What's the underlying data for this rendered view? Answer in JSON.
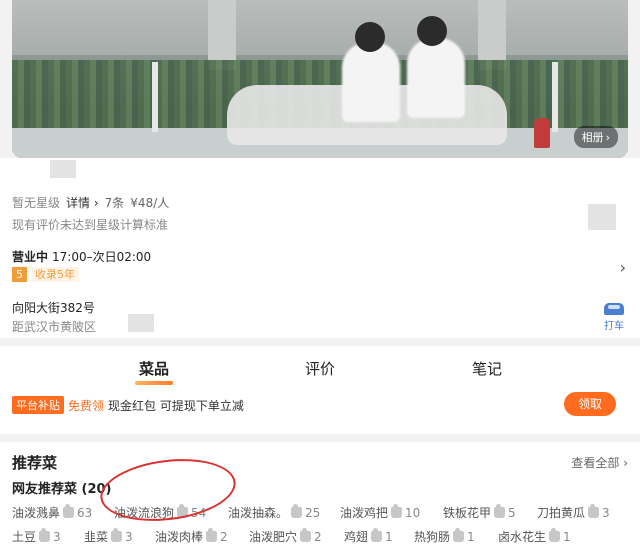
{
  "photo": {
    "album_label": "相册"
  },
  "info": {
    "rating": "暂无星级",
    "detail_label": "详情",
    "review_count": "7条",
    "avg_price": "¥48/人",
    "rating_note": "现有评价未达到星级计算标准",
    "status": "营业中",
    "hours": "17:00–次日02:00",
    "years_badge_num": "5",
    "years_badge_text": "收录5年",
    "address": "向阳大街382号",
    "distance": "距武汉市黄陂区",
    "taxi_label": "打车"
  },
  "tabs": [
    {
      "label": "菜品",
      "active": true
    },
    {
      "label": "评价",
      "active": false
    },
    {
      "label": "笔记",
      "active": false
    }
  ],
  "promo": {
    "tag": "平台补贴",
    "free": "免费领",
    "text": "现金红包 可提现下单立减",
    "button": "领取"
  },
  "dishes": {
    "title": "推荐菜",
    "see_all": "查看全部",
    "subtitle": "网友推荐菜 (20)",
    "items": [
      {
        "name": "油泼溅鼻",
        "count": "63"
      },
      {
        "name": "油泼流浪狗",
        "count": "54"
      },
      {
        "name": "油泼抽森。",
        "count": "25"
      },
      {
        "name": "油泼鸡把",
        "count": "10"
      },
      {
        "name": "铁板花甲",
        "count": "5"
      },
      {
        "name": "刀拍黄瓜",
        "count": "3"
      },
      {
        "name": "土豆",
        "count": "3"
      },
      {
        "name": "韭菜",
        "count": "3"
      },
      {
        "name": "油泼肉棒",
        "count": "2"
      },
      {
        "name": "油泼肥穴",
        "count": "2"
      },
      {
        "name": "鸡翅",
        "count": "1"
      },
      {
        "name": "热狗肠",
        "count": "1"
      },
      {
        "name": "卤水花生",
        "count": "1"
      }
    ]
  }
}
